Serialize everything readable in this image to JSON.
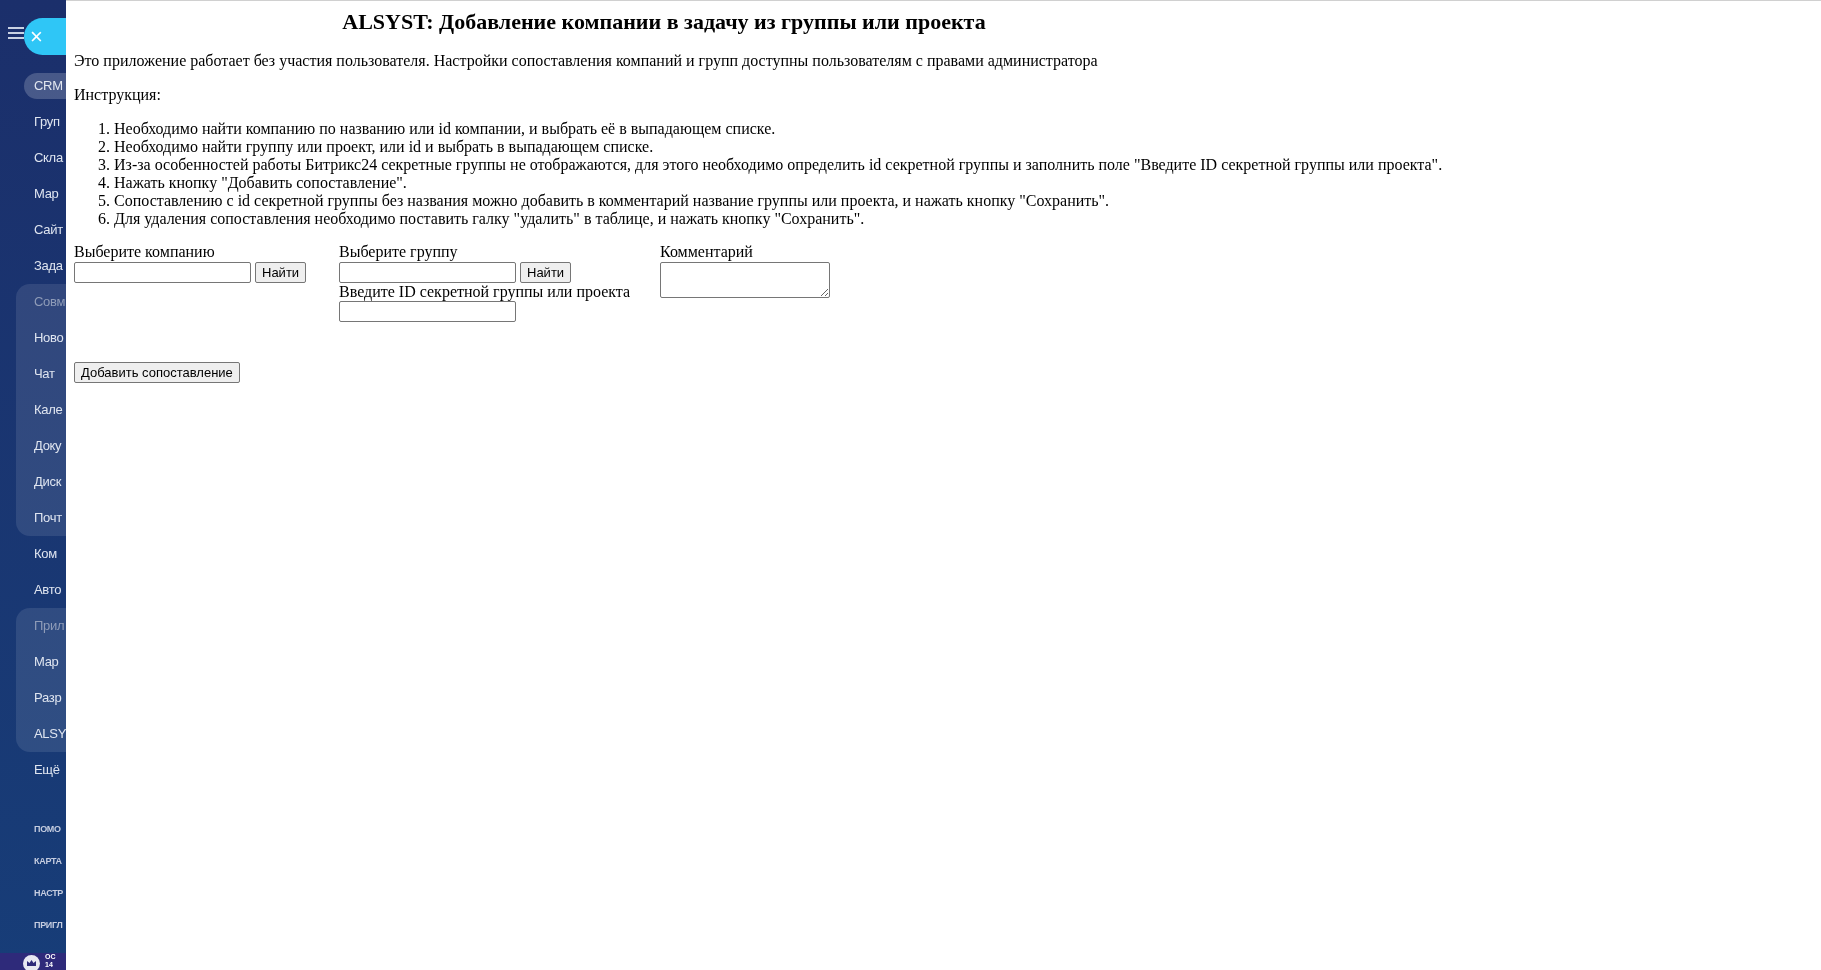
{
  "sidebar": {
    "close_button": "×",
    "items": [
      {
        "kind": "item",
        "label": "CRM",
        "selected": true
      },
      {
        "kind": "item",
        "label": "Груп",
        "selected": false
      },
      {
        "kind": "item",
        "label": "Скла",
        "selected": false
      },
      {
        "kind": "item",
        "label": "Мар",
        "selected": false
      },
      {
        "kind": "item",
        "label": "Сайт",
        "selected": false
      },
      {
        "kind": "item",
        "label": "Зада",
        "selected": false
      },
      {
        "kind": "group",
        "label": "Совм",
        "children": [
          {
            "label": "Ново",
            "selected": false
          },
          {
            "label": "Чат",
            "selected": false
          },
          {
            "label": "Кале",
            "selected": false
          },
          {
            "label": "Доку",
            "selected": false
          },
          {
            "label": "Диск",
            "selected": false
          },
          {
            "label": "Почт",
            "selected": false
          }
        ]
      },
      {
        "kind": "item",
        "label": "Ком",
        "selected": false
      },
      {
        "kind": "item",
        "label": "Авто",
        "selected": false
      },
      {
        "kind": "group",
        "label": "Прил",
        "children": [
          {
            "label": "Мар",
            "selected": false
          },
          {
            "label": "Разр",
            "selected": false
          },
          {
            "label": "ALSY",
            "selected": false
          }
        ]
      },
      {
        "kind": "item",
        "label": "Ещё",
        "selected": false
      }
    ],
    "footer_links": [
      "ПОМО",
      "КАРТА",
      "НАСТР",
      "ПРИГЛ"
    ],
    "plan": {
      "line_1": "ОС",
      "line_2": "14"
    }
  },
  "panel": {
    "title": "ALSYST: Добавление компании в задачу из группы или проекта",
    "intro": "Это приложение работает без участия пользователя. Настройки сопоставления компаний и групп доступны пользователям с правами администратора",
    "instruction_heading": "Инструкция:",
    "steps": [
      {
        "number": "1.",
        "text": "Необходимо найти компанию по названию или id компании, и выбрать её в выпадающем списке."
      },
      {
        "number": "2.",
        "text": "Необходимо найти группу или проект, или id и выбрать в выпадающем списке."
      },
      {
        "number": "3.",
        "text": "Из-за особенностей работы Битрикс24 секретные группы не отображаются, для этого необходимо определить id секретной группы и заполнить поле \"Введите ID секретной группы или проекта\"."
      },
      {
        "number": "4.",
        "text": "Нажать кнопку \"Добавить сопоставление\"."
      },
      {
        "number": "5.",
        "text": "Сопоставлению с id секретной группы без названия можно добавить в комментарий название группы или проекта, и нажать кнопку \"Сохранить\"."
      },
      {
        "number": "6.",
        "text": "Для удаления сопоставления необходимо поставить галку \"удалить\" в таблице, и нажать кнопку \"Сохранить\"."
      }
    ],
    "form": {
      "company": {
        "label": "Выберите компанию",
        "button": "Найти"
      },
      "group": {
        "label": "Выберите группу",
        "button": "Найти",
        "secret_label": "Введите ID секретной группы или проекта"
      },
      "comment": {
        "label": "Комментарий"
      },
      "add_button": "Добавить сопоставление"
    }
  }
}
